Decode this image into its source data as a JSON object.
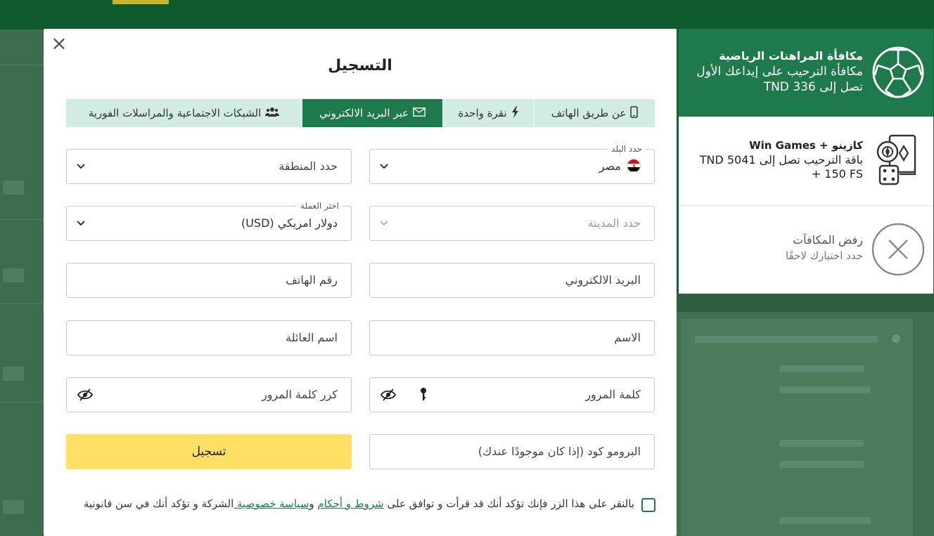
{
  "modal": {
    "close_symbol": "×",
    "title": "التسجيل",
    "tabs": [
      {
        "label": "عن طريق الهاتف",
        "icon": "phone-icon"
      },
      {
        "label": "نقرة واحدة",
        "icon": "lightning-icon"
      },
      {
        "label": "عبر البريد الالكتروني",
        "icon": "envelope-icon",
        "active": true
      },
      {
        "label": "الشبكات الاجتماعية والمراسلات الفورية",
        "icon": "users-icon"
      }
    ],
    "fields": {
      "country": {
        "legend": "حدد البلد",
        "value": "مصر"
      },
      "region": {
        "placeholder": "حدد المنطقة"
      },
      "city": {
        "placeholder": "حدد المدينة"
      },
      "currency": {
        "legend": "اختر العملة",
        "value": "دولار امريكي (USD)"
      },
      "email": {
        "placeholder": "البريد الالكتروني"
      },
      "phone": {
        "placeholder": "رقم الهاتف"
      },
      "first_name": {
        "placeholder": "الاسم"
      },
      "last_name": {
        "placeholder": "اسم العائلة"
      },
      "password": {
        "placeholder": "كلمة المرور"
      },
      "confirm_password": {
        "placeholder": "كرر كلمة المرور"
      },
      "promo": {
        "placeholder": "البرومو كود (إذا كان موجودًا عندك)"
      }
    },
    "register_label": "تسجيل",
    "terms": {
      "part1": "بالنقر على هذا الزر فإنك تؤكد أنك قد قرأت و توافق على ",
      "link1": "شروط و أحكام",
      "part2": " و",
      "link2": "سياسة خصوصية ",
      "part3": "الشركة و تؤكد أنك في سن قانونية"
    }
  },
  "bonuses": {
    "sport": {
      "title": "مكافأة المراهنات الرياضية",
      "desc": "مكافأة الترحيب على إيداعك الأول تصل إلى 336 TND",
      "icon": "football-icon"
    },
    "casino": {
      "title": "كازينو + Win Games",
      "desc": "باقة الترحيب تصل إلى 5041 TND + 150 FS",
      "icon": "cards-dice-icon"
    },
    "refuse": {
      "title": "رفض المكافآت",
      "desc": "حدد اختيارك لاحقًا",
      "icon": "close-circle-icon"
    }
  },
  "colors": {
    "accent": "#1e7a4d",
    "button": "#fde064",
    "tab_bg": "#d3ece2"
  }
}
